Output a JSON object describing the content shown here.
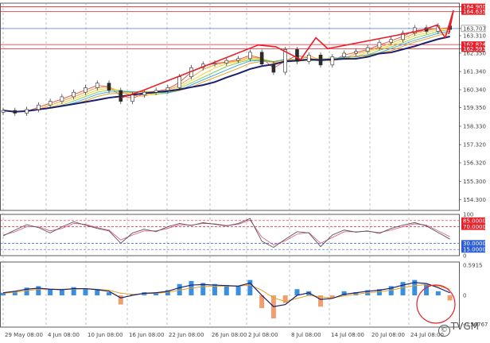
{
  "watermark": "TVGM",
  "colors": {
    "grid": "#9a9a9a",
    "candle": "#2b2b2b",
    "ma_fast": "#e0303a",
    "ma_mid": "#e8a020",
    "ma_slow": "#1b1f6e",
    "ma_rainbow": [
      "#e94b3c",
      "#f29b26",
      "#f2d22e",
      "#7cc84a",
      "#2ea8d8"
    ],
    "annotation": "#e8202a",
    "level_line": "#e8202a",
    "current_line": "#2a5bd7",
    "osc_line": "#555555",
    "osc_signal": "#e84a8a",
    "macd_pos": "#3a8fe0",
    "macd_neg": "#f0a070",
    "macd_line": "#1b1f6e",
    "macd_signal": "#e8a020"
  },
  "chart_data": [
    {
      "type": "candlestick",
      "panel": "price",
      "x_labels": [
        "29 May 08:00",
        "4 Jun 08:00",
        "10 Jun 08:00",
        "16 Jun 08:00",
        "22 Jun 08:00",
        "26 Jun 08:00",
        "2 Jul 08:00",
        "8 Jul 08:00",
        "14 Jul 08:00",
        "20 Jul 08:00",
        "24 Jul 08:00"
      ],
      "y_ticks": [
        164.9,
        164.635,
        163.707,
        163.31,
        162.824,
        162.593,
        162.35,
        161.34,
        160.34,
        159.35,
        158.33,
        157.32,
        156.32,
        155.3,
        154.3
      ],
      "y_range": [
        153.7,
        165.1
      ],
      "levels": [
        164.9,
        164.635,
        162.824,
        162.593
      ],
      "current_price": 163.707,
      "close": [
        159.2,
        159.05,
        159.25,
        159.5,
        159.7,
        159.95,
        160.2,
        160.45,
        160.7,
        160.3,
        159.7,
        160.05,
        160.2,
        160.3,
        160.45,
        161.05,
        161.55,
        161.75,
        161.8,
        161.95,
        162.05,
        162.4,
        161.75,
        161.3,
        162.55,
        161.9,
        162.25,
        161.7,
        162.15,
        162.35,
        162.45,
        162.65,
        162.95,
        163.1,
        163.45,
        163.75,
        163.55,
        163.85,
        163.65
      ],
      "annotations": [
        {
          "x": 10.05,
          "y": 159.9
        },
        {
          "x": 11.9,
          "y": 160.3
        },
        {
          "x": 21.7,
          "y": 162.8
        },
        {
          "x": 23.2,
          "y": 162.7
        },
        {
          "x": 25.3,
          "y": 162.0
        },
        {
          "x": 26.6,
          "y": 163.2
        },
        {
          "x": 27.6,
          "y": 162.6
        },
        {
          "x": 35.6,
          "y": 163.6
        },
        {
          "x": 36.9,
          "y": 163.9
        },
        {
          "x": 37.6,
          "y": 163.2
        },
        {
          "x": 38.3,
          "y": 164.7
        },
        {
          "x": 37.9,
          "y": 163.4
        }
      ]
    },
    {
      "type": "line",
      "panel": "stochastic",
      "y_ticks": [
        100,
        85.0,
        70.0,
        30.0,
        15.0,
        0
      ],
      "y_range": [
        0,
        100
      ],
      "levels": [
        85,
        70,
        30,
        15
      ],
      "main": [
        48,
        62,
        75,
        68,
        55,
        70,
        82,
        74,
        66,
        60,
        30,
        55,
        64,
        58,
        70,
        78,
        73,
        80,
        76,
        72,
        78,
        90,
        35,
        20,
        40,
        58,
        55,
        22,
        50,
        62,
        57,
        60,
        54,
        66,
        74,
        80,
        72,
        56,
        40
      ],
      "signal": [
        50,
        58,
        70,
        70,
        60,
        66,
        78,
        76,
        68,
        62,
        38,
        50,
        60,
        60,
        66,
        75,
        74,
        78,
        77,
        73,
        76,
        86,
        45,
        26,
        36,
        52,
        56,
        30,
        44,
        58,
        58,
        59,
        56,
        62,
        70,
        77,
        74,
        60,
        46
      ]
    },
    {
      "type": "bar",
      "panel": "macd",
      "y_ticks": [
        0.5915,
        0.0,
        -0.56767
      ],
      "y_range": [
        -0.62,
        0.65
      ],
      "histogram": [
        0.05,
        0.08,
        0.15,
        0.18,
        0.12,
        0.1,
        0.16,
        0.14,
        0.1,
        0.06,
        -0.18,
        0.02,
        0.06,
        0.06,
        0.1,
        0.22,
        0.28,
        0.24,
        0.22,
        0.2,
        0.18,
        0.3,
        -0.25,
        -0.45,
        -0.15,
        0.12,
        0.08,
        -0.22,
        -0.05,
        0.08,
        0.06,
        0.1,
        0.12,
        0.18,
        0.26,
        0.3,
        0.22,
        0.08,
        -0.1
      ],
      "macd": [
        0.05,
        0.08,
        0.12,
        0.14,
        0.12,
        0.11,
        0.13,
        0.13,
        0.11,
        0.08,
        -0.05,
        0.0,
        0.04,
        0.05,
        0.08,
        0.15,
        0.2,
        0.21,
        0.2,
        0.19,
        0.18,
        0.24,
        0.0,
        -0.22,
        -0.18,
        0.0,
        0.05,
        -0.08,
        -0.06,
        0.02,
        0.05,
        0.08,
        0.1,
        0.14,
        0.2,
        0.25,
        0.23,
        0.15,
        0.05
      ],
      "signal": [
        0.04,
        0.06,
        0.09,
        0.12,
        0.12,
        0.12,
        0.12,
        0.13,
        0.12,
        0.1,
        0.04,
        0.02,
        0.03,
        0.04,
        0.06,
        0.1,
        0.14,
        0.17,
        0.18,
        0.18,
        0.18,
        0.2,
        0.1,
        -0.05,
        -0.12,
        -0.06,
        0.0,
        -0.03,
        -0.05,
        -0.01,
        0.02,
        0.05,
        0.07,
        0.1,
        0.15,
        0.19,
        0.21,
        0.18,
        0.12
      ]
    }
  ]
}
